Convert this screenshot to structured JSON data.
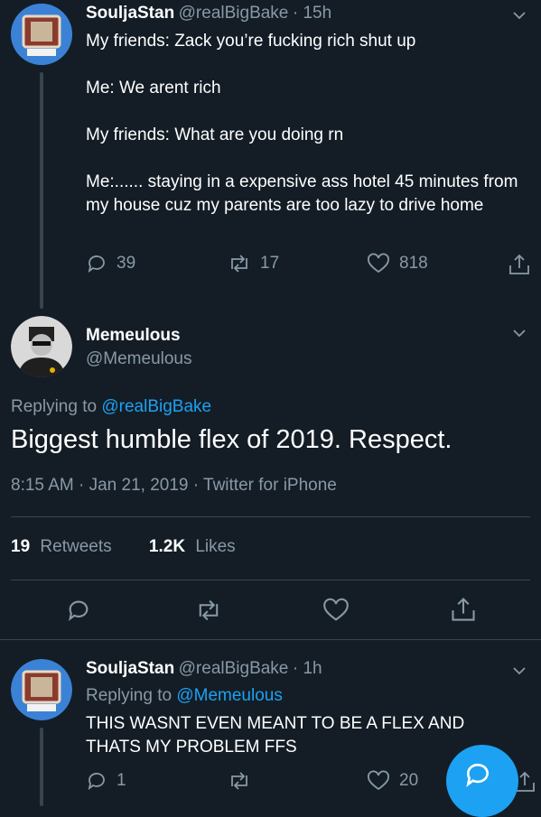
{
  "tweet1": {
    "name": "SouljaStan",
    "handle": "@realBigBake",
    "time": "· 15h",
    "lines": [
      "My friends: Zack you’re fucking rich shut up",
      "Me: We arent rich",
      "My friends: What are you doing rn",
      "Me:...... staying in a expensive ass hotel 45 minutes from my house cuz my parents are too lazy to drive home"
    ],
    "replies": "39",
    "retweets": "17",
    "likes": "818"
  },
  "main": {
    "name": "Memeulous",
    "handle": "@Memeulous",
    "replying_prefix": "Replying to",
    "replying_to": "@realBigBake",
    "text": "Biggest humble flex of 2019. Respect.",
    "meta": "8:15 AM · Jan 21, 2019 · Twitter for iPhone",
    "retweet_count": "19",
    "retweet_label": "Retweets",
    "like_count": "1.2K",
    "like_label": "Likes"
  },
  "tweet3": {
    "name": "SouljaStan",
    "handle": "@realBigBake",
    "time": "· 1h",
    "replying_prefix": "Replying to",
    "replying_to": "@Memeulous",
    "text": "THIS WASNT EVEN MEANT TO BE A FLEX AND THATS MY PROBLEM FFS",
    "replies": "1",
    "likes": "20"
  },
  "colors": {
    "background": "#141d26",
    "accent": "#1da1f2",
    "muted": "#8899a6",
    "divider": "#38444d"
  },
  "icons": [
    "avatar-icon",
    "chevron-down-icon",
    "reply-icon",
    "retweet-icon",
    "heart-icon",
    "share-icon",
    "compose-reply-icon"
  ]
}
